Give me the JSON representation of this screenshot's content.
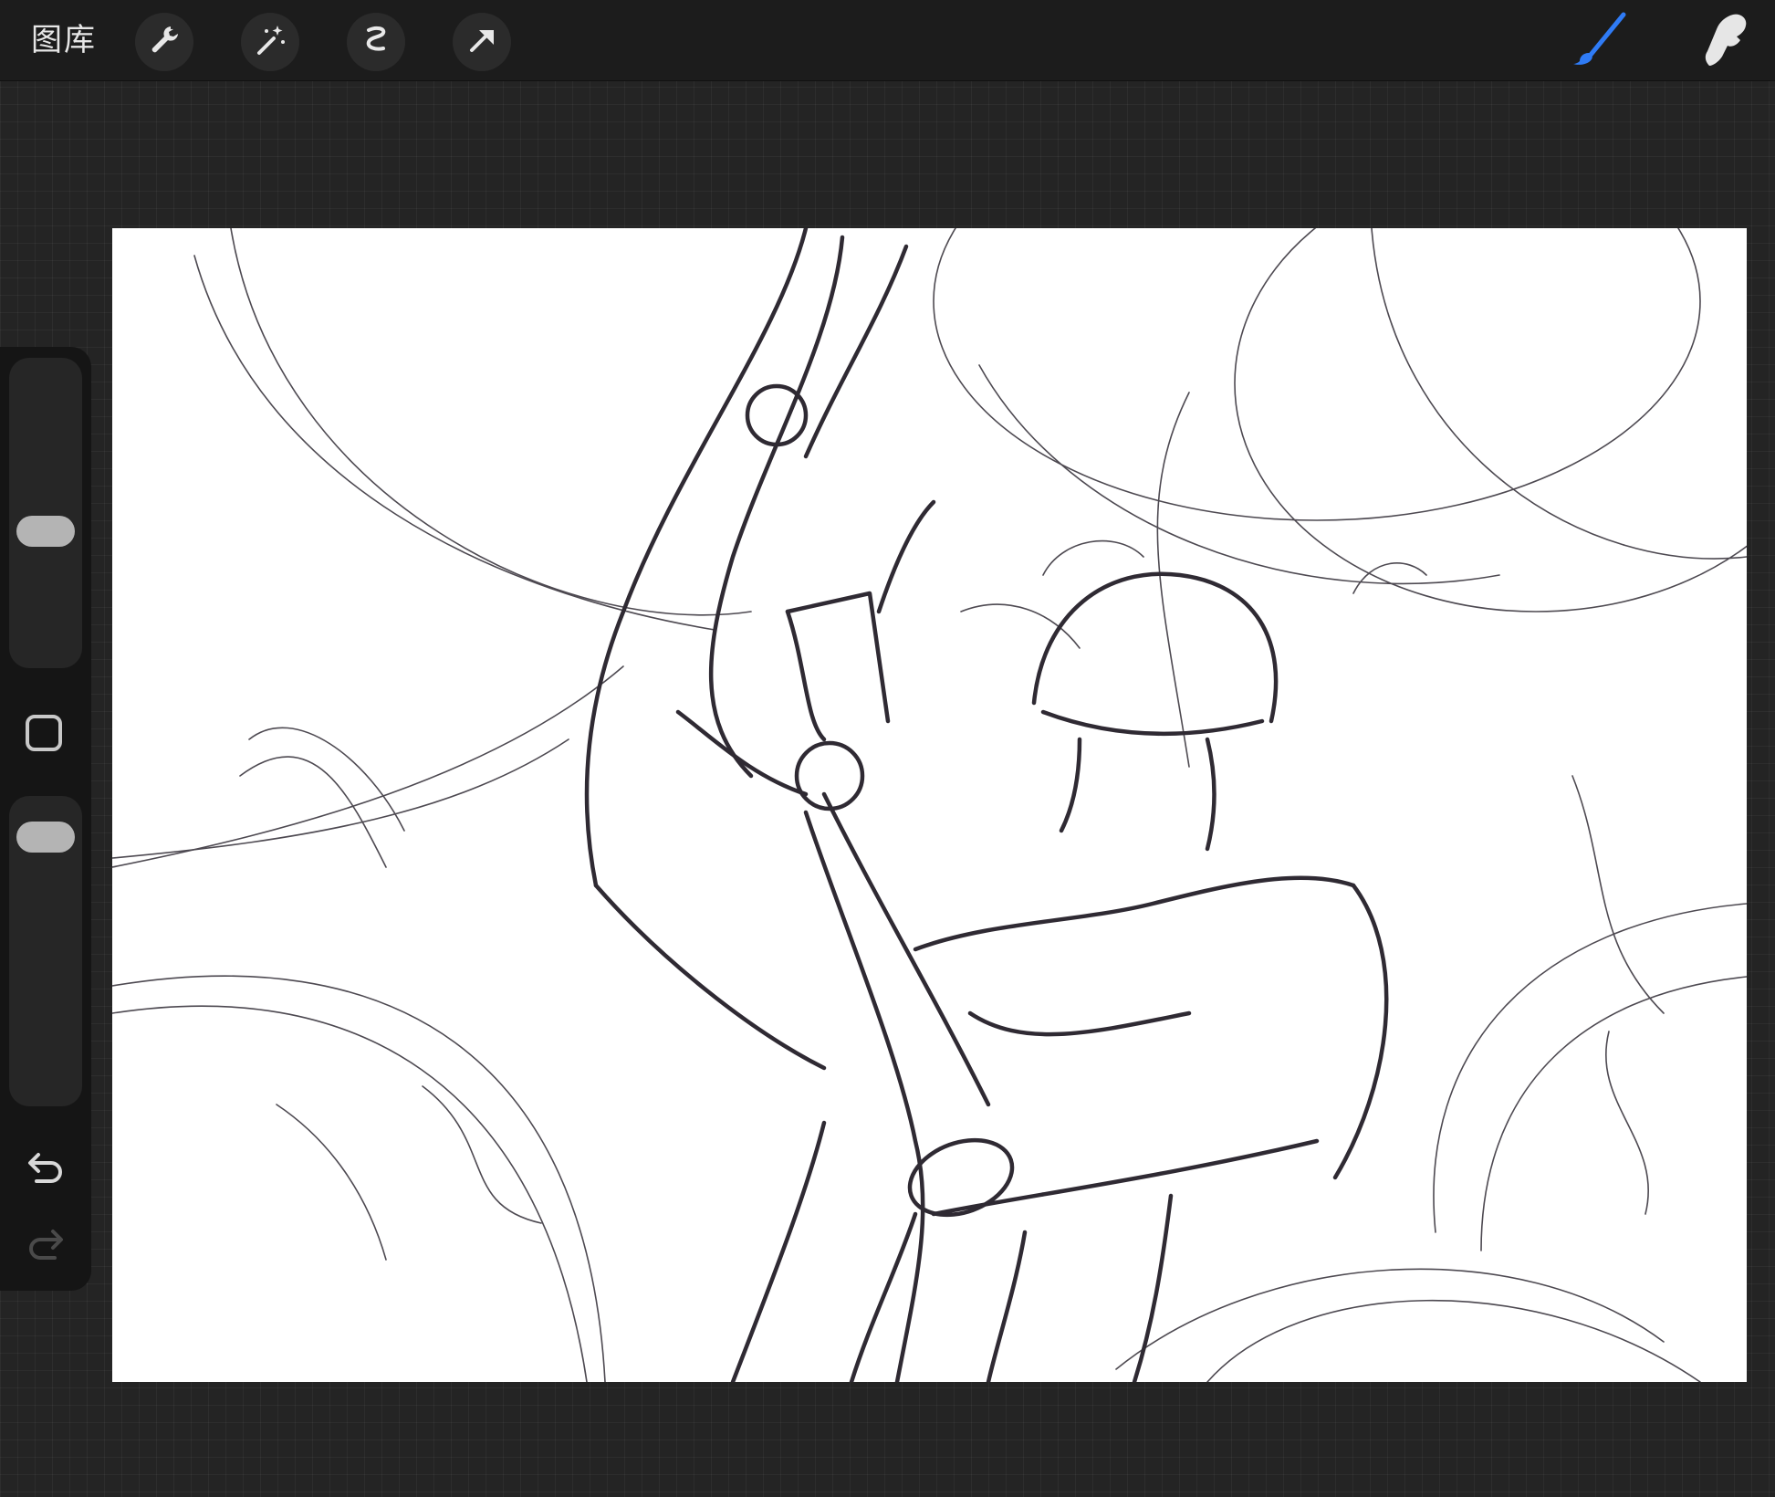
{
  "toolbar": {
    "gallery_label": "图库",
    "left_tools": [
      "wrench-icon",
      "magic-wand-icon",
      "selection-icon",
      "transform-arrow-icon"
    ],
    "right_tools": [
      "brush-icon",
      "smudge-icon"
    ],
    "active_tool": "brush-icon",
    "active_color": "#2f7bf5"
  },
  "sidebar": {
    "brush_size_level": 0.43,
    "opacity_level": 0.93,
    "modify_button_icon": "square-icon",
    "undo_icon": "undo-icon",
    "redo_icon": "redo-icon",
    "redo_enabled": false
  },
  "canvas": {
    "background": "#ffffff",
    "stroke_color": "#2f2a33"
  }
}
